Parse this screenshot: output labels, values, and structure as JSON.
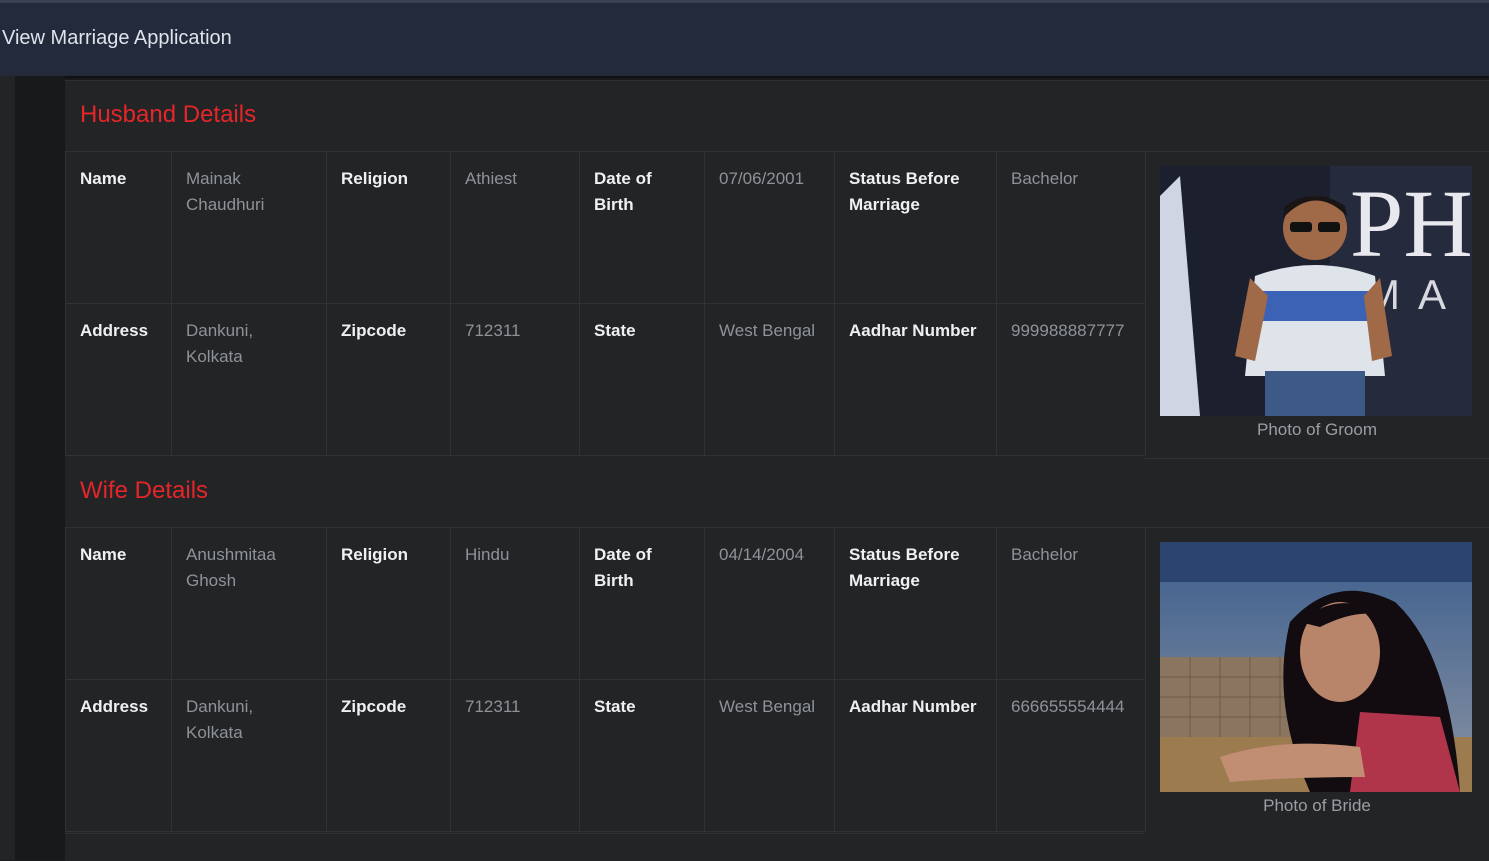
{
  "header": {
    "title": "View Marriage Application"
  },
  "husband": {
    "section_title": "Husband Details",
    "labels": {
      "name": "Name",
      "religion": "Religion",
      "dob": "Date of Birth",
      "status": "Status Before Marriage",
      "address": "Address",
      "zipcode": "Zipcode",
      "state": "State",
      "aadhar": "Aadhar Number"
    },
    "values": {
      "name": "Mainak Chaudhuri",
      "religion": "Athiest",
      "dob": "07/06/2001",
      "status": "Bachelor",
      "address": "Dankuni, Kolkata",
      "zipcode": "712311",
      "state": "West Bengal",
      "aadhar": "999988887777"
    },
    "photo_caption": "Photo of Groom"
  },
  "wife": {
    "section_title": "Wife Details",
    "labels": {
      "name": "Name",
      "religion": "Religion",
      "dob": "Date of Birth",
      "status": "Status Before Marriage",
      "address": "Address",
      "zipcode": "Zipcode",
      "state": "State",
      "aadhar": "Aadhar Number"
    },
    "values": {
      "name": "Anushmitaa Ghosh",
      "religion": "Hindu",
      "dob": "04/14/2004",
      "status": "Bachelor",
      "address": "Dankuni, Kolkata",
      "zipcode": "712311",
      "state": "West Bengal",
      "aadhar": "666655554444"
    },
    "photo_caption": "Photo of Bride"
  },
  "colors": {
    "section_title": "#e4262a",
    "header_bg": "#232a3b",
    "panel_bg": "#222426"
  }
}
